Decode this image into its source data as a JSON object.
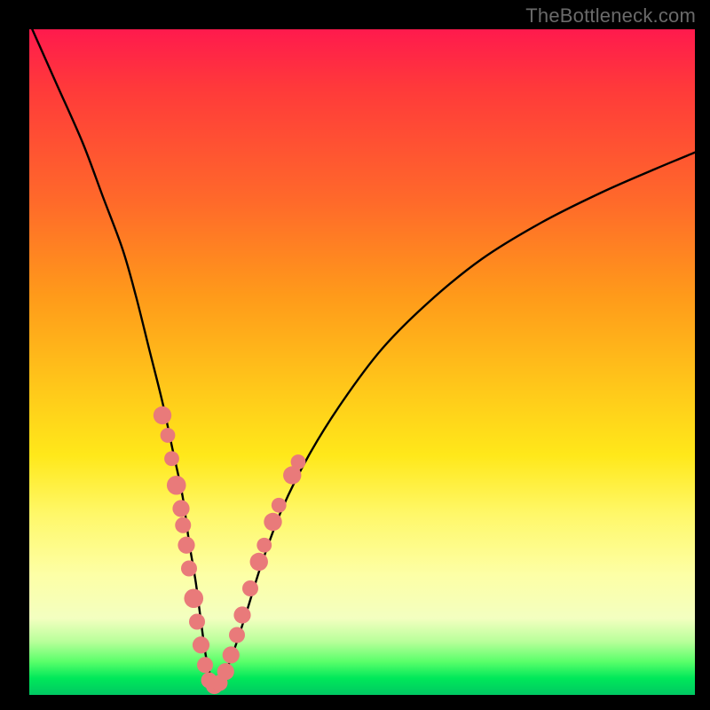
{
  "watermark": "TheBottleneck.com",
  "chart_data": {
    "type": "line",
    "title": "",
    "xlabel": "",
    "ylabel": "",
    "xlim": [
      0,
      100
    ],
    "ylim": [
      0,
      100
    ],
    "note": "V-shaped bottleneck curve; axes unlabeled; x/y are normalized 0–100 within the plot-area. Higher y = higher bottleneck.",
    "series": [
      {
        "name": "bottleneck-curve",
        "x": [
          0,
          4,
          8,
          11,
          14,
          16,
          18,
          20,
          21.5,
          23,
          24,
          25,
          25.8,
          26.5,
          27.2,
          28,
          29,
          30.5,
          32.5,
          35,
          38,
          42,
          47,
          53,
          60,
          68,
          77,
          86,
          94,
          100
        ],
        "y": [
          101,
          92,
          83,
          75,
          67,
          60,
          52,
          44,
          37,
          30,
          23,
          17,
          11,
          6,
          3,
          1.5,
          2.5,
          6,
          12,
          20,
          28,
          36,
          44,
          52,
          59,
          65.5,
          71,
          75.5,
          79,
          81.5
        ]
      }
    ],
    "markers": {
      "name": "highlighted-points",
      "points": [
        {
          "x": 20.0,
          "y": 42.0,
          "r": 1.7
        },
        {
          "x": 20.8,
          "y": 39.0,
          "r": 1.4
        },
        {
          "x": 21.4,
          "y": 35.5,
          "r": 1.4
        },
        {
          "x": 22.1,
          "y": 31.5,
          "r": 1.8
        },
        {
          "x": 22.8,
          "y": 28.0,
          "r": 1.6
        },
        {
          "x": 23.1,
          "y": 25.5,
          "r": 1.5
        },
        {
          "x": 23.6,
          "y": 22.5,
          "r": 1.6
        },
        {
          "x": 24.0,
          "y": 19.0,
          "r": 1.5
        },
        {
          "x": 24.7,
          "y": 14.5,
          "r": 1.8
        },
        {
          "x": 25.2,
          "y": 11.0,
          "r": 1.5
        },
        {
          "x": 25.8,
          "y": 7.5,
          "r": 1.6
        },
        {
          "x": 26.4,
          "y": 4.5,
          "r": 1.5
        },
        {
          "x": 27.0,
          "y": 2.2,
          "r": 1.5
        },
        {
          "x": 27.8,
          "y": 1.4,
          "r": 1.6
        },
        {
          "x": 28.6,
          "y": 1.8,
          "r": 1.5
        },
        {
          "x": 29.5,
          "y": 3.5,
          "r": 1.6
        },
        {
          "x": 30.3,
          "y": 6.0,
          "r": 1.6
        },
        {
          "x": 31.2,
          "y": 9.0,
          "r": 1.5
        },
        {
          "x": 32.0,
          "y": 12.0,
          "r": 1.6
        },
        {
          "x": 33.2,
          "y": 16.0,
          "r": 1.5
        },
        {
          "x": 34.5,
          "y": 20.0,
          "r": 1.7
        },
        {
          "x": 35.3,
          "y": 22.5,
          "r": 1.4
        },
        {
          "x": 36.6,
          "y": 26.0,
          "r": 1.7
        },
        {
          "x": 37.5,
          "y": 28.5,
          "r": 1.4
        },
        {
          "x": 39.5,
          "y": 33.0,
          "r": 1.7
        },
        {
          "x": 40.4,
          "y": 35.0,
          "r": 1.4
        }
      ]
    }
  }
}
